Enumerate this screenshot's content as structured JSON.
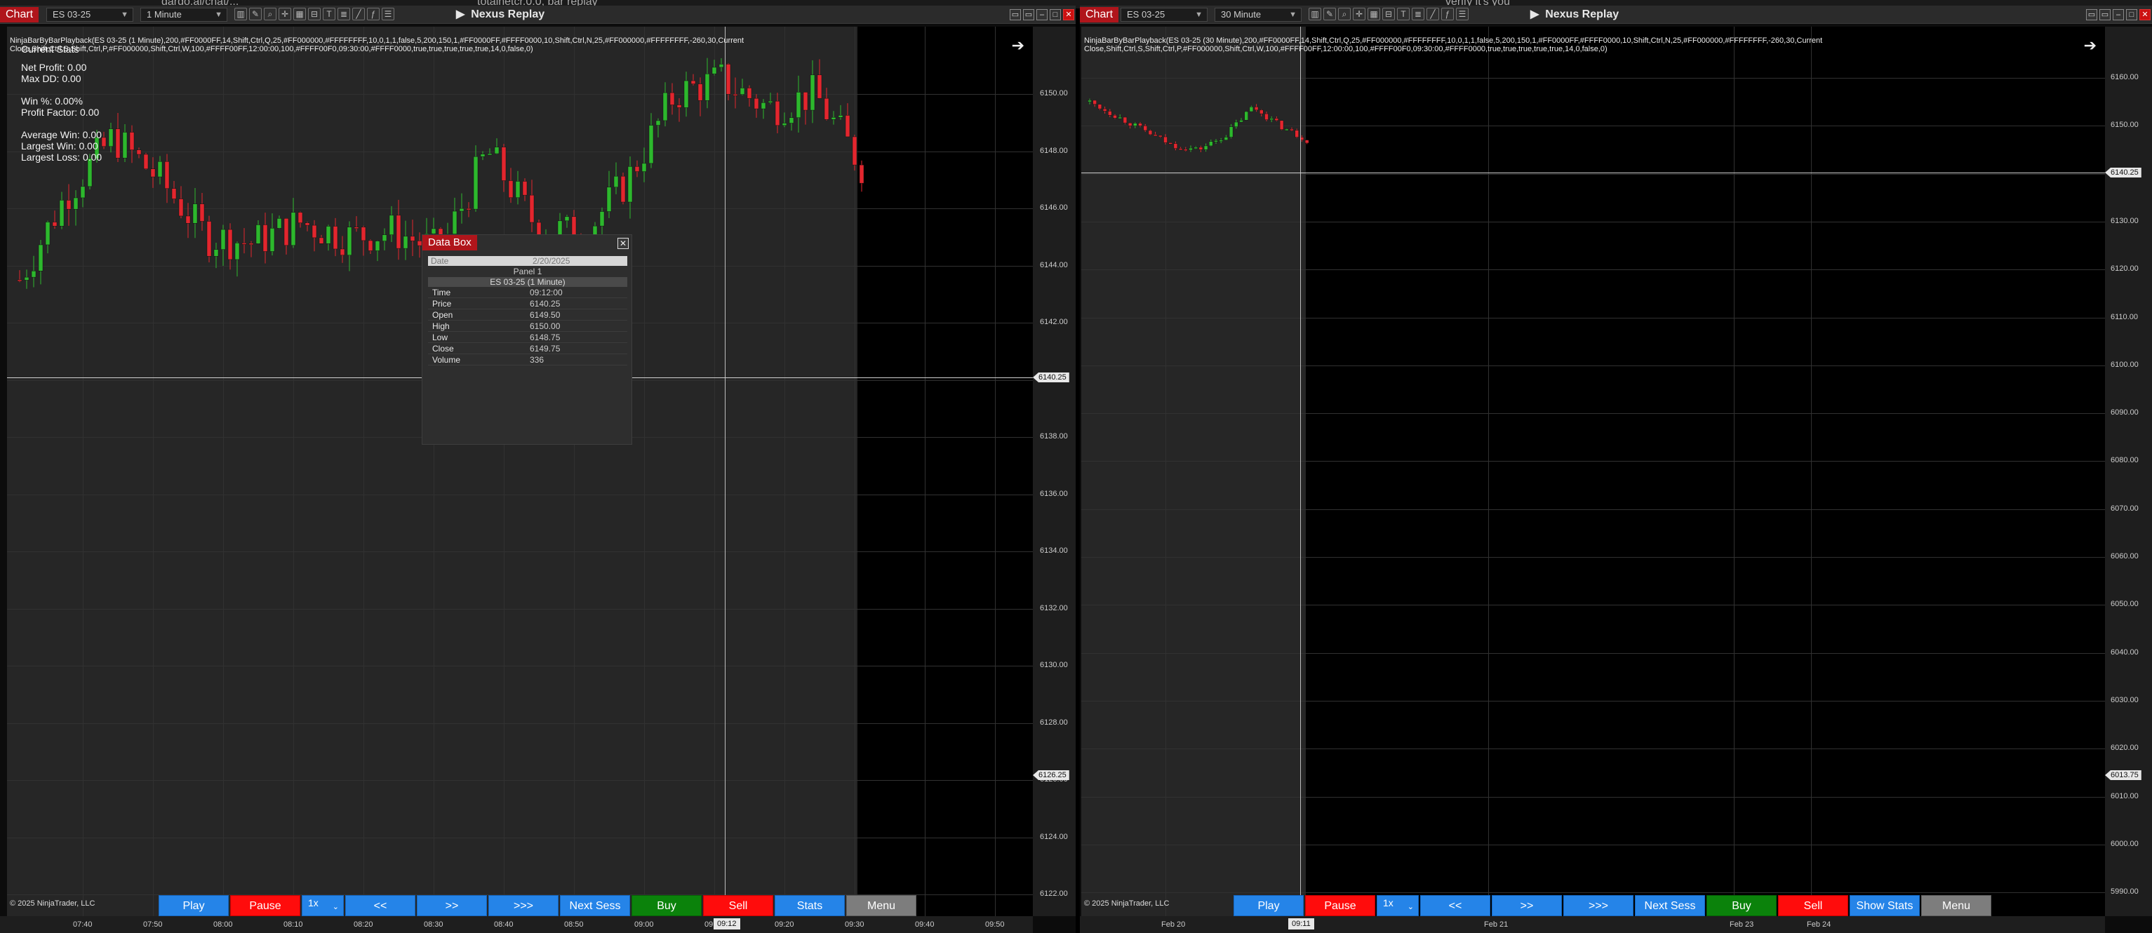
{
  "top_strip": {
    "text_left": "dardo.ai/chat/...",
    "text_mid": "totalnetcr.0.0, bar replay",
    "text_right": "verify it's you"
  },
  "left": {
    "chart_label": "Chart",
    "instrument": "ES 03-25",
    "interval": "1 Minute",
    "app_title": "Nexus Replay",
    "indicator_text": "NinjaBarByBarPlayback(ES 03-25 (1 Minute),200,#FF0000FF,14,Shift,Ctrl,Q,25,#FF000000,#FFFFFFFF,10,0,1,1,false,5,200,150,1,#FF0000FF,#FFFF0000,10,Shift,Ctrl,N,25,#FF000000,#FFFFFFFF,-260,30,Current Close,Shift,Ctrl,S,Shift,Ctrl,P,#FF000000,Shift,Ctrl,W,100,#FFFF00FF,12:00:00,100,#FFFF00F0,09:30:00,#FFFF0000,true,true,true,true,true,14,0,false,0)",
    "stats_title": "Current Stats",
    "stats": [
      "Net Profit: 0.00",
      "Max DD: 0.00",
      "",
      "Win %: 0.00%",
      "Profit Factor: 0.00",
      "",
      "Average Win: 0.00",
      "Largest Win: 0.00",
      "Largest Loss: 0.00"
    ],
    "copyright": "© 2025 NinjaTrader, LLC",
    "y_labels": [
      "6150.00",
      "6148.00",
      "6146.00",
      "6144.00",
      "6142.00",
      "6140.00",
      "6138.00",
      "6136.00",
      "6134.00",
      "6132.00",
      "6130.00",
      "6128.00",
      "6126.00",
      "6124.00",
      "6122.00"
    ],
    "price_badge_1": "6140.25",
    "price_badge_2": "6126.25",
    "x_labels": [
      "07:40",
      "07:50",
      "08:00",
      "08:10",
      "08:20",
      "08:30",
      "08:40",
      "08:50",
      "09:00",
      "09:10",
      "09:20",
      "09:30",
      "09:40",
      "09:50"
    ],
    "x_badge": "09:12",
    "buttons": [
      "Play",
      "Pause",
      "1x",
      "<<",
      ">>",
      ">>>",
      "Next Sess",
      "Buy",
      "Sell",
      "Stats",
      "Menu"
    ],
    "databox": {
      "title": "Data Box",
      "date_label": "Date",
      "date_value": "2/20/2025",
      "panel": "Panel 1",
      "series": "ES 03-25 (1 Minute)",
      "rows": [
        {
          "k": "Time",
          "v": "09:12:00"
        },
        {
          "k": "Price",
          "v": "6140.25"
        },
        {
          "k": "Open",
          "v": "6149.50"
        },
        {
          "k": "High",
          "v": "6150.00"
        },
        {
          "k": "Low",
          "v": "6148.75"
        },
        {
          "k": "Close",
          "v": "6149.75"
        },
        {
          "k": "Volume",
          "v": "336"
        }
      ]
    }
  },
  "right": {
    "chart_label": "Chart",
    "instrument": "ES 03-25",
    "interval": "30 Minute",
    "app_title": "Nexus Replay",
    "indicator_text": "NinjaBarByBarPlayback(ES 03-25 (30 Minute),200,#FF0000FF,14,Shift,Ctrl,Q,25,#FF000000,#FFFFFFFF,10,0,1,1,false,5,200,150,1,#FF0000FF,#FFFF0000,10,Shift,Ctrl,N,25,#FF000000,#FFFFFFFF,-260,30,Current Close,Shift,Ctrl,S,Shift,Ctrl,P,#FF000000,Shift,Ctrl,W,100,#FFFF00FF,12:00:00,100,#FFFF00F0,09:30:00,#FFFF0000,true,true,true,true,true,14,0,false,0)",
    "copyright": "© 2025 NinjaTrader, LLC",
    "y_labels": [
      "6160.00",
      "6150.00",
      "6140.00",
      "6130.00",
      "6120.00",
      "6110.00",
      "6100.00",
      "6090.00",
      "6080.00",
      "6070.00",
      "6060.00",
      "6050.00",
      "6040.00",
      "6030.00",
      "6020.00",
      "6010.00",
      "6000.00",
      "5990.00"
    ],
    "price_badge_1": "6140.25",
    "price_badge_2": "6013.75",
    "x_labels": [
      "Feb 20",
      "Feb 21",
      "Feb 23",
      "Feb 24"
    ],
    "x_badge": "09:11",
    "buttons": [
      "Play",
      "Pause",
      "1x",
      "<<",
      ">>",
      ">>>",
      "Next Sess",
      "Buy",
      "Sell",
      "Show Stats",
      "Menu"
    ]
  },
  "colors": {
    "up": "#2db82d",
    "down": "#e3262e",
    "chart_red": "#b0151b",
    "btn_blue": "#2584e8",
    "btn_red": "#ff0c0c",
    "btn_green": "#0b820b",
    "btn_gray": "#7d7d7d"
  }
}
